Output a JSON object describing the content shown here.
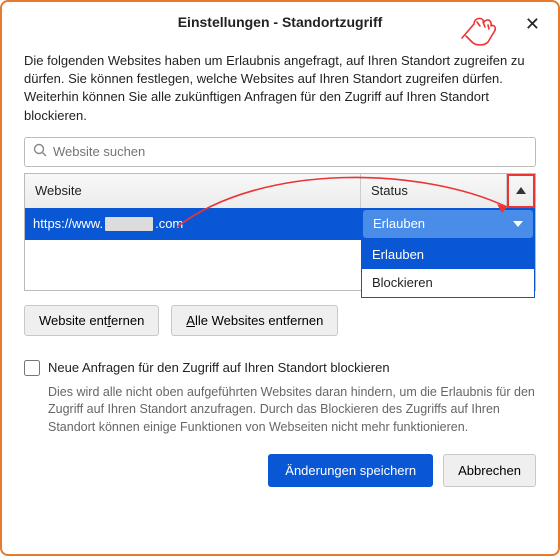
{
  "title": "Einstellungen - Standortzugriff",
  "description": "Die folgenden Websites haben um Erlaubnis angefragt, auf Ihren Standort zugreifen zu dürfen. Sie können festlegen, welche Websites auf Ihren Standort zugreifen dürfen. Weiterhin können Sie alle zukünftigen Anfragen für den Zugriff auf Ihren Standort blockieren.",
  "search": {
    "placeholder": "Website suchen"
  },
  "table": {
    "head_website": "Website",
    "head_status": "Status"
  },
  "row": {
    "url_prefix": "https://www.",
    "url_suffix": ".com",
    "status_selected": "Erlauben"
  },
  "dropdown": {
    "opt1": "Erlauben",
    "opt2": "Blockieren"
  },
  "buttons": {
    "remove_pre": "Website ent",
    "remove_u": "f",
    "remove_post": "ernen",
    "remove_all_u": "A",
    "remove_all_post": "lle Websites entfernen",
    "save": "Änderungen speichern",
    "cancel": "Abbrechen"
  },
  "block_new": {
    "label": "Neue Anfragen für den Zugriff auf Ihren Standort blockieren",
    "help": "Dies wird alle nicht oben aufgeführten Websites daran hindern, um die Erlaubnis für den Zugriff auf Ihren Standort anzufragen. Durch das Blockieren des Zugriffs auf Ihren Standort können einige Funktionen von Webseiten nicht mehr funktionieren."
  }
}
